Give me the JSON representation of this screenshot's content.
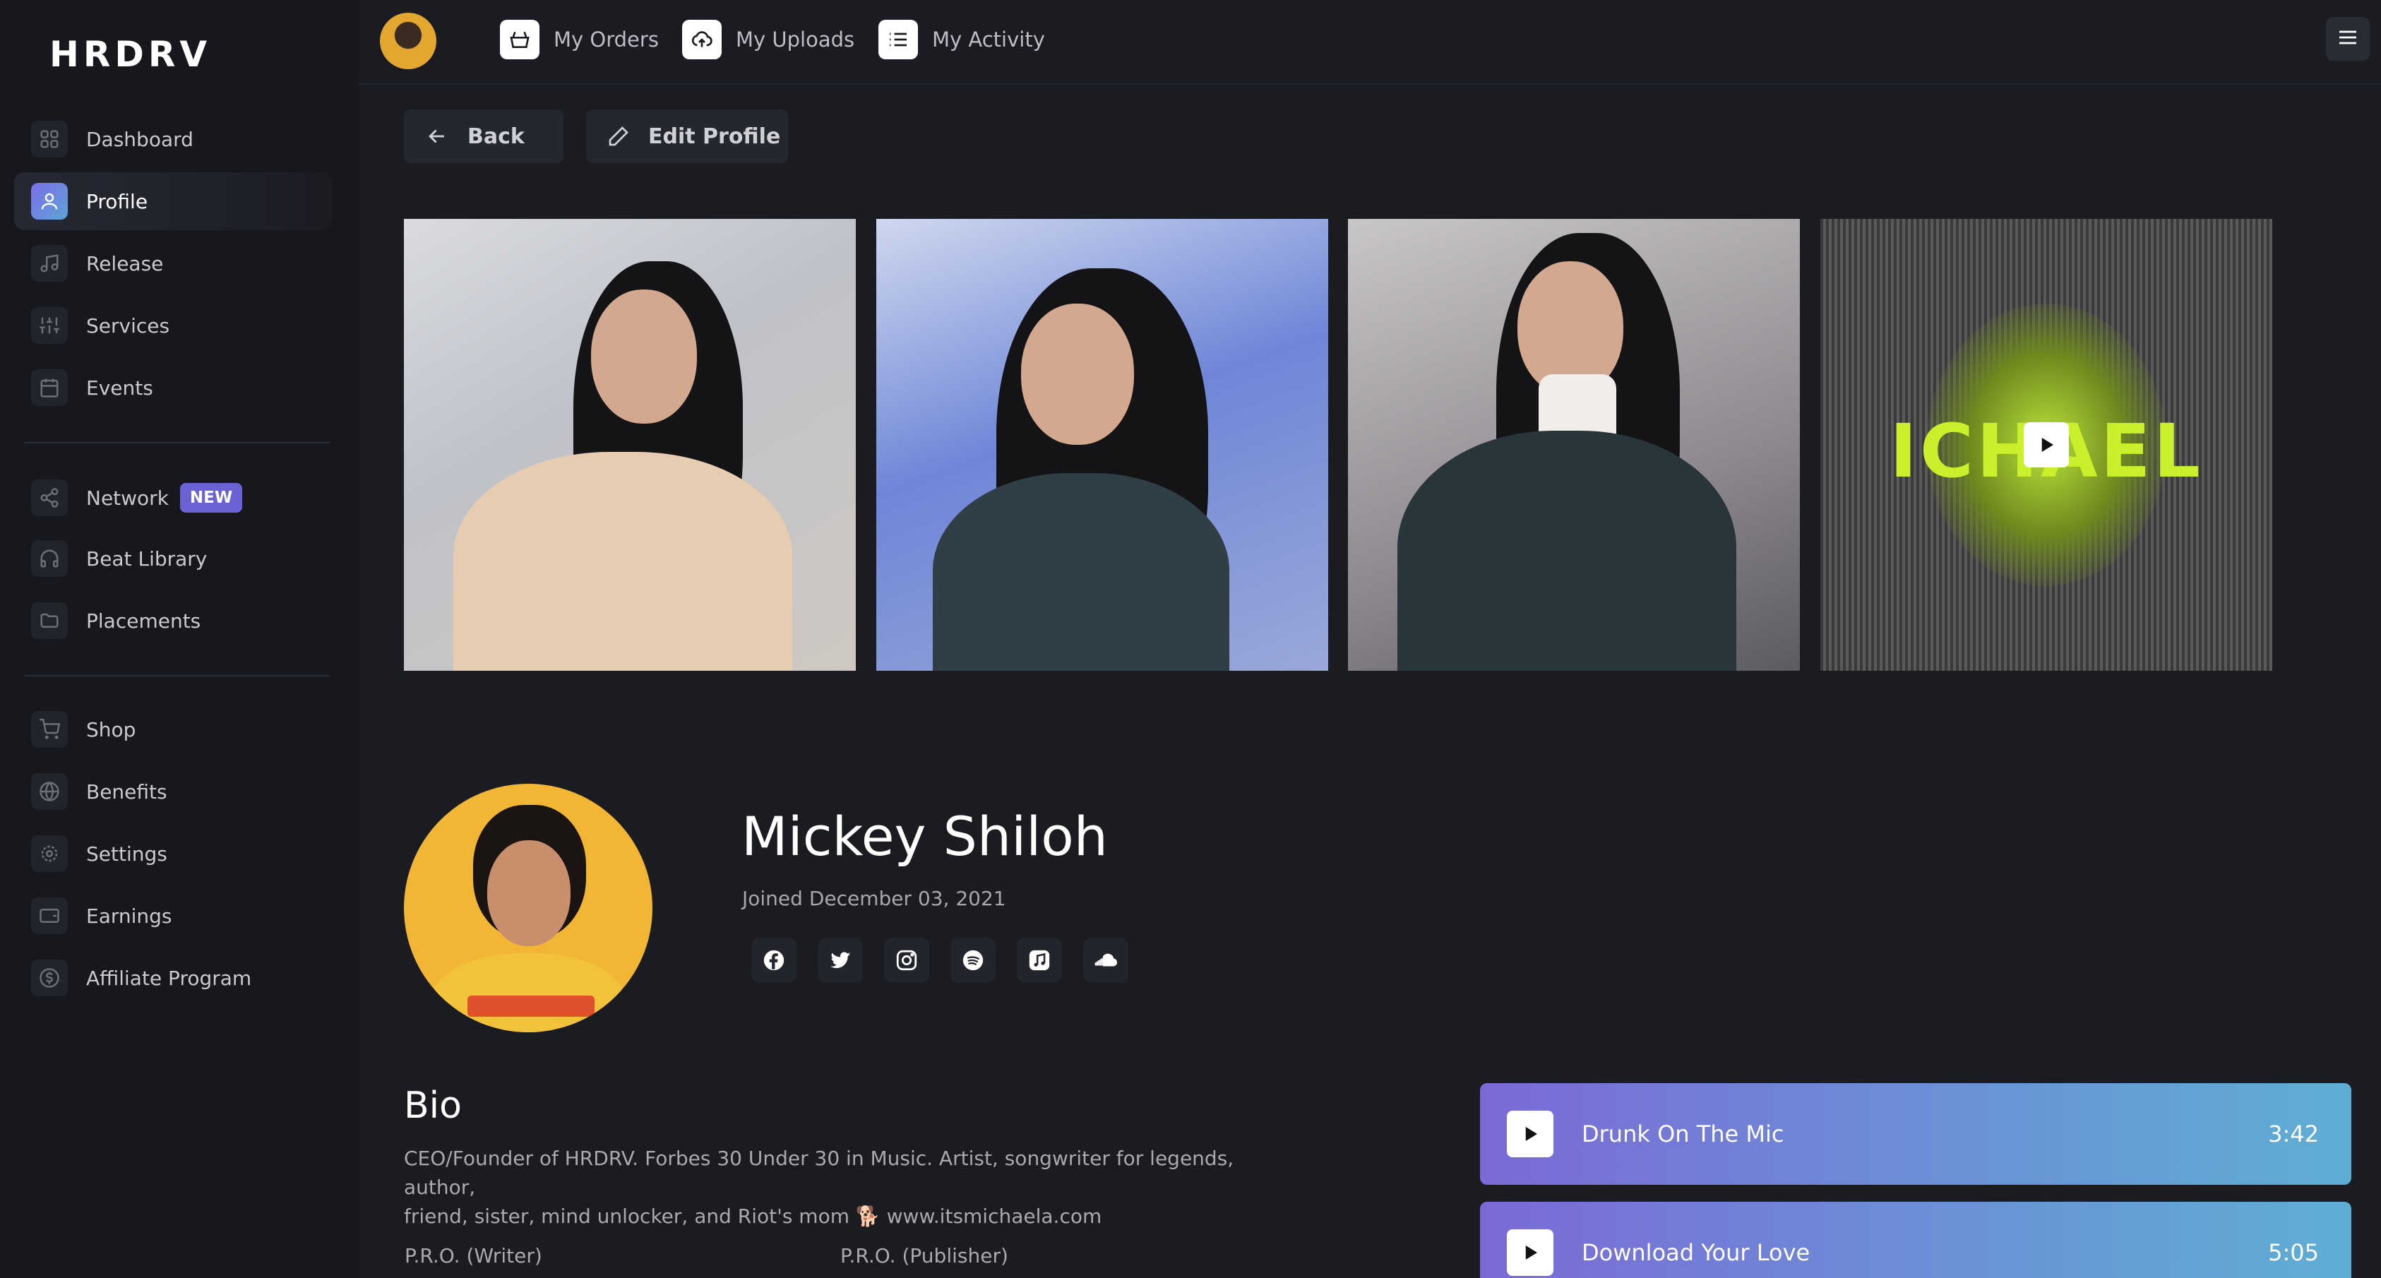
{
  "app": {
    "logo": "HRDRV"
  },
  "sidebar": {
    "items": [
      {
        "label": "Dashboard",
        "icon": "grid-icon"
      },
      {
        "label": "Profile",
        "icon": "user-icon",
        "active": true
      },
      {
        "label": "Release",
        "icon": "music-note-icon"
      },
      {
        "label": "Services",
        "icon": "sliders-icon"
      },
      {
        "label": "Events",
        "icon": "calendar-icon"
      },
      {
        "label": "Network",
        "icon": "share-icon",
        "badge": "NEW"
      },
      {
        "label": "Beat Library",
        "icon": "headphones-icon"
      },
      {
        "label": "Placements",
        "icon": "folder-icon"
      },
      {
        "label": "Shop",
        "icon": "cart-icon"
      },
      {
        "label": "Benefits",
        "icon": "globe-icon"
      },
      {
        "label": "Settings",
        "icon": "gear-icon"
      },
      {
        "label": "Earnings",
        "icon": "wallet-icon"
      },
      {
        "label": "Affiliate Program",
        "icon": "dollar-icon"
      }
    ]
  },
  "topbar": {
    "links": [
      {
        "label": "My Orders",
        "icon": "basket-icon"
      },
      {
        "label": "My Uploads",
        "icon": "upload-cloud-icon"
      },
      {
        "label": "My Activity",
        "icon": "list-icon"
      }
    ]
  },
  "actions": {
    "back": "Back",
    "edit": "Edit Profile"
  },
  "gallery": {
    "video_text": "ICHAEL"
  },
  "profile": {
    "name": "Mickey Shiloh",
    "joined": "Joined December 03, 2021",
    "socials": [
      "facebook-icon",
      "twitter-icon",
      "instagram-icon",
      "spotify-icon",
      "apple-music-icon",
      "soundcloud-icon"
    ]
  },
  "bio": {
    "title": "Bio",
    "line1": "CEO/Founder of HRDRV. Forbes 30 Under 30 in Music. Artist, songwriter for legends, author,",
    "line2": "friend, sister, mind unlocker, and Riot's mom 🐕 www.itsmichaela.com",
    "pro_writer": "P.R.O. (Writer)",
    "pro_publisher": "P.R.O. (Publisher)"
  },
  "tracks": [
    {
      "title": "Drunk On The Mic",
      "duration": "3:42"
    },
    {
      "title": "Download Your Love",
      "duration": "5:05"
    }
  ],
  "colors": {
    "accent": "#6b62d6",
    "background": "#1b1c22",
    "sidebar": "#17181d"
  }
}
